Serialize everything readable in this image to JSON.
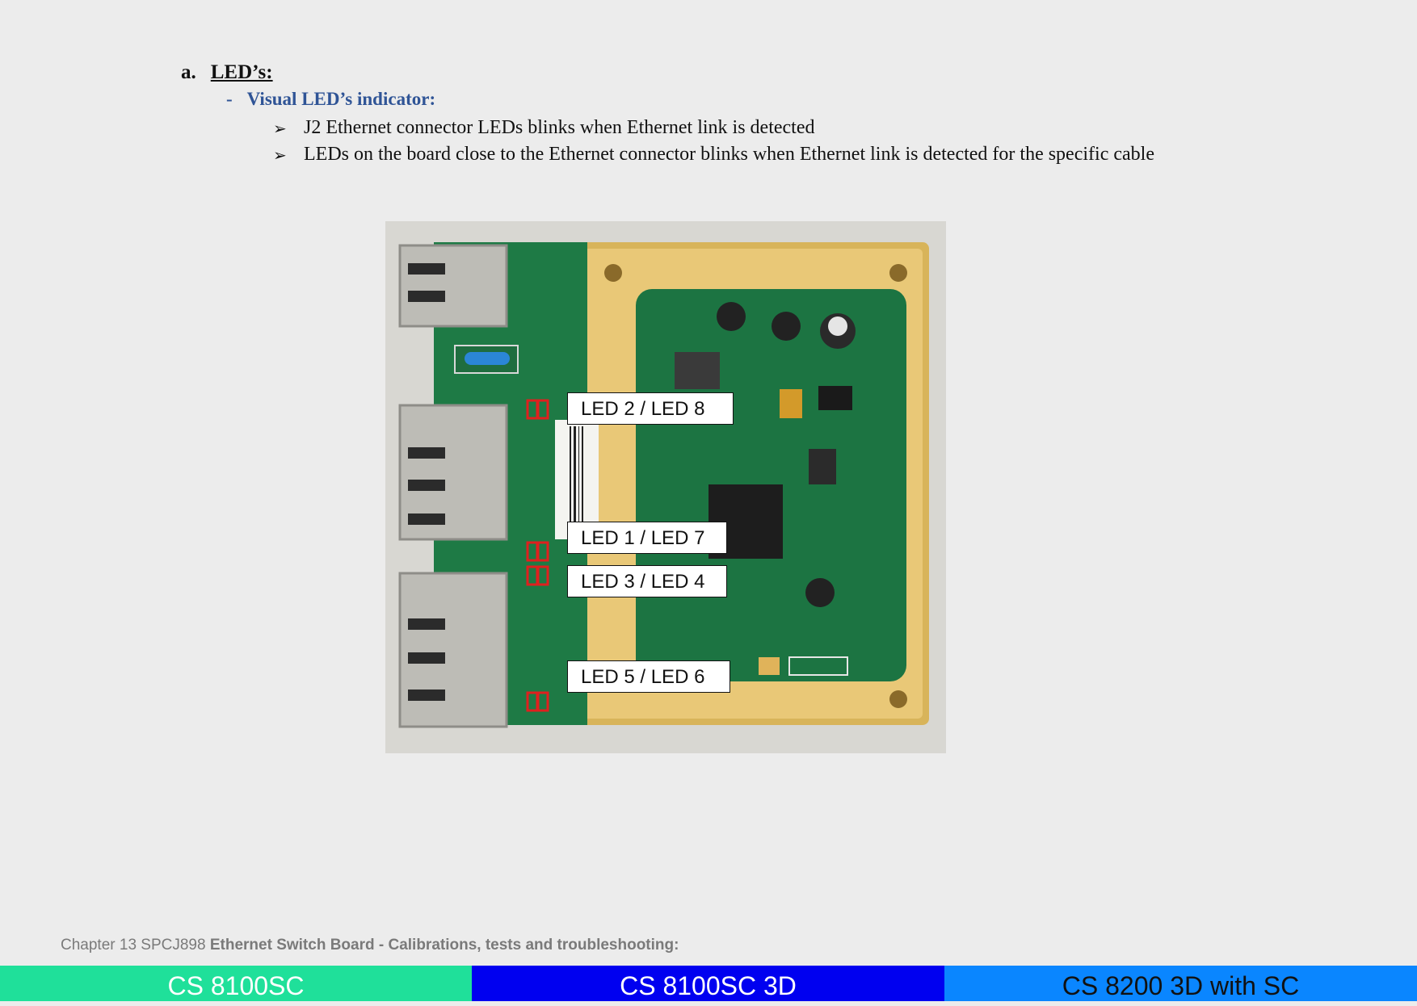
{
  "section": {
    "marker": "a.",
    "title": "LED’s:"
  },
  "subsection": {
    "marker": "-",
    "title": "Visual LED’s indicator:"
  },
  "bullets": [
    "J2 Ethernet connector LEDs blinks when Ethernet link is detected",
    "LEDs on the board close to the Ethernet connector blinks when Ethernet link is detected for the specific cable"
  ],
  "bullet_icon": "arrow-bullet-icon",
  "photo": {
    "led_labels": [
      "LED 2 / LED 8",
      "LED 1 / LED 7",
      "LED 3 / LED 4",
      "LED 5 / LED 6"
    ]
  },
  "footer": {
    "chapter": "Chapter 13 SPCJ898 ",
    "chapter_title": "Ethernet Switch Board - Calibrations, tests and troubleshooting:"
  },
  "tabs": [
    {
      "label": "CS 8100SC",
      "color": "#1fe09a"
    },
    {
      "label": "CS 8100SC 3D",
      "color": "#0000f0"
    },
    {
      "label": "CS 8200 3D with SC",
      "color": "#0a86ff"
    }
  ]
}
